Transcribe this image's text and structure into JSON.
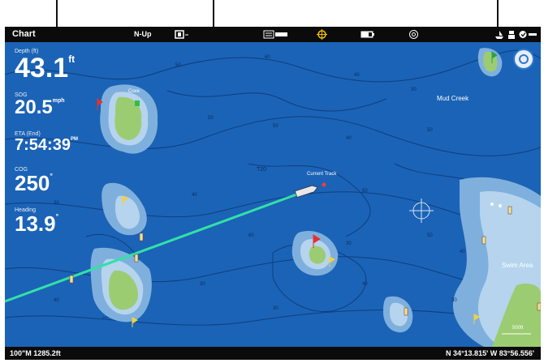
{
  "topbar": {
    "title": "Chart",
    "orientation": "N-Up",
    "icons": [
      "screen-icon",
      "sonar-icon",
      "gps-icon",
      "battery-icon",
      "target-icon",
      "boat-icon",
      "anchor-icon",
      "status-icon"
    ]
  },
  "digits": {
    "depth": {
      "label": "Depth (ft)",
      "value": "43.1",
      "unit": "ft"
    },
    "sog": {
      "label": "SOG",
      "value": "20.5",
      "unit": "mph"
    },
    "eta": {
      "label": "ETA (End)",
      "value": "7:54:39",
      "unit": "PM"
    },
    "cog": {
      "label": "COG",
      "value": "250",
      "unit": "°"
    },
    "heading": {
      "label": "Heading",
      "value": "13.9",
      "unit": "°"
    }
  },
  "map": {
    "labels": {
      "mudcreek": "Mud Creek",
      "current_track": "Current Track",
      "swim_area": "Swim Area",
      "cove": "Cove",
      "t20": "T20"
    },
    "scale_text": "500ft"
  },
  "bottombar": {
    "left_text": "100\"M 1285.2ft",
    "right_text": "N 34°13.815' W 83°56.556'"
  }
}
